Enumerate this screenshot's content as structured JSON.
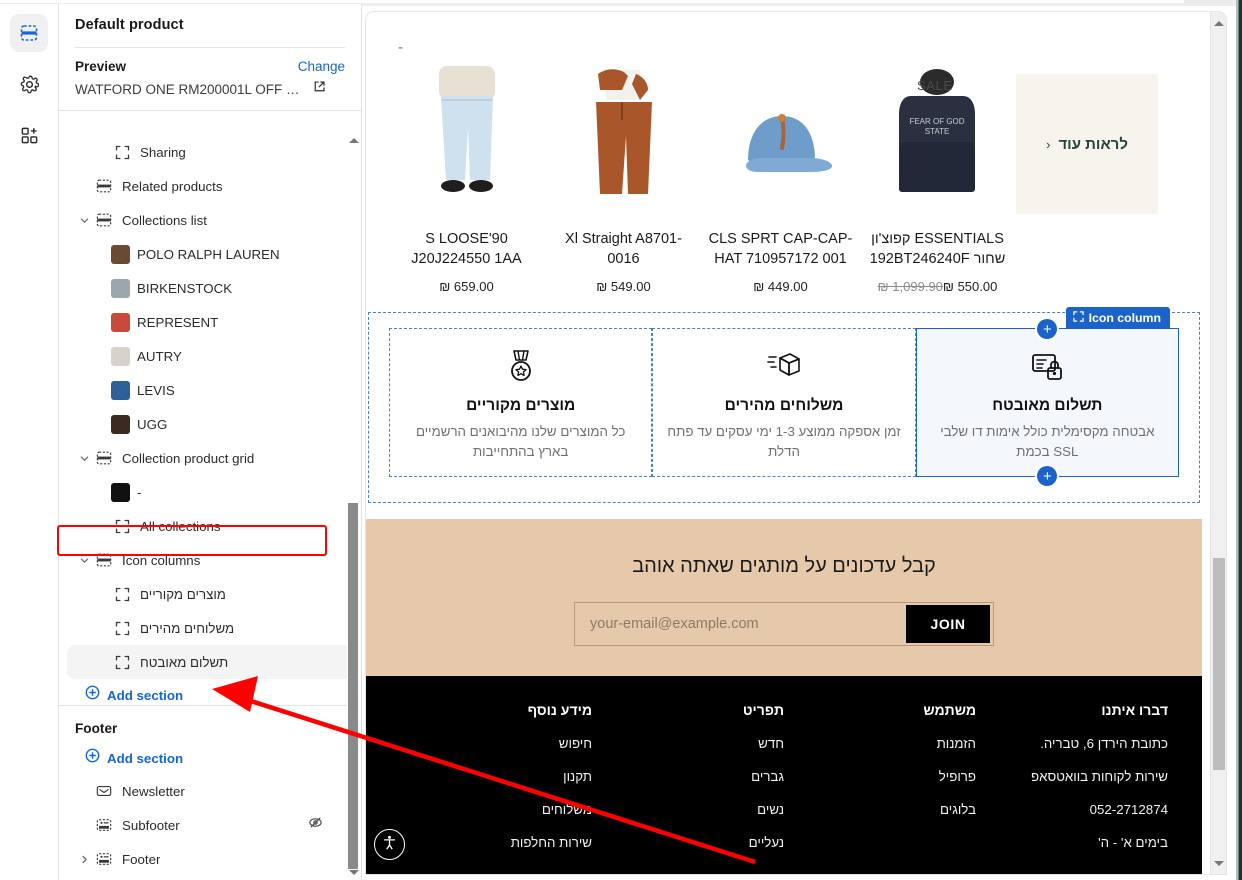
{
  "rail": {
    "items": [
      {
        "name": "sections-icon",
        "active": true
      },
      {
        "name": "settings-gear-icon",
        "active": false
      },
      {
        "name": "apps-add-icon",
        "active": false
      }
    ]
  },
  "sidebar": {
    "title": "Default product",
    "preview": {
      "label": "Preview",
      "change_label": "Change",
      "product_name": "WATFORD ONE RM200001L OFF WH..."
    },
    "tree": [
      {
        "label": "Sharing",
        "icon": "placeholder-block-icon",
        "indent": 2,
        "chevron": "none",
        "kind": "block"
      },
      {
        "label": "Related products",
        "icon": "section-icon",
        "indent": 1,
        "chevron": "none",
        "kind": "section"
      },
      {
        "label": "Collections list",
        "icon": "section-icon",
        "indent": 1,
        "chevron": "down",
        "kind": "section"
      },
      {
        "label": "POLO RALPH LAUREN",
        "icon": "thumb",
        "indent": 2,
        "chevron": "none",
        "kind": "thumb",
        "color": "#6b4a33"
      },
      {
        "label": "BIRKENSTOCK",
        "icon": "thumb",
        "indent": 2,
        "chevron": "none",
        "kind": "thumb",
        "color": "#9aa7ae"
      },
      {
        "label": "REPRESENT",
        "icon": "thumb",
        "indent": 2,
        "chevron": "none",
        "kind": "thumb",
        "color": "#c84a3a"
      },
      {
        "label": "AUTRY",
        "icon": "thumb",
        "indent": 2,
        "chevron": "none",
        "kind": "thumb",
        "color": "#d7d3cb"
      },
      {
        "label": "LEVIS",
        "icon": "thumb",
        "indent": 2,
        "chevron": "none",
        "kind": "thumb",
        "color": "#2f5f98"
      },
      {
        "label": "UGG",
        "icon": "thumb",
        "indent": 2,
        "chevron": "none",
        "kind": "thumb",
        "color": "#3a2a20"
      },
      {
        "label": "Collection product grid",
        "icon": "section-icon",
        "indent": 1,
        "chevron": "down",
        "kind": "section"
      },
      {
        "label": "-",
        "icon": "thumb",
        "indent": 2,
        "chevron": "none",
        "kind": "thumb",
        "color": "#111111"
      },
      {
        "label": "All collections",
        "icon": "placeholder-block-icon",
        "indent": 2,
        "chevron": "none",
        "kind": "block"
      },
      {
        "label": "Icon columns",
        "icon": "section-icon",
        "indent": 1,
        "chevron": "down",
        "kind": "section",
        "highlighted": true
      },
      {
        "label": "מוצרים מקוריים",
        "icon": "placeholder-block-icon",
        "indent": 2,
        "chevron": "none",
        "kind": "block",
        "rtl": true
      },
      {
        "label": "משלוחים מהירים",
        "icon": "placeholder-block-icon",
        "indent": 2,
        "chevron": "none",
        "kind": "block",
        "rtl": true
      },
      {
        "label": "תשלום מאובטח",
        "icon": "placeholder-block-icon",
        "indent": 2,
        "chevron": "none",
        "kind": "block",
        "rtl": true,
        "selected": true
      }
    ],
    "add_section_label": "Add section",
    "footer_group": {
      "title": "Footer",
      "add_section_label": "Add section",
      "items": [
        {
          "label": "Newsletter",
          "icon": "envelope-icon",
          "chevron": "none",
          "hidden": false
        },
        {
          "label": "Subfooter",
          "icon": "footer-icon",
          "chevron": "none",
          "hidden": true
        },
        {
          "label": "Footer",
          "icon": "footer-icon",
          "chevron": "right",
          "hidden": false
        }
      ]
    }
  },
  "preview": {
    "placeholder_dash": "-",
    "products": [
      {
        "name": "S LOOSE'90 J20J224550 1AA",
        "price": "₪ 659.00",
        "compare_price": "",
        "sale": false,
        "rtl": false
      },
      {
        "name": "Xl Straight A8701-0016",
        "price": "₪ 549.00",
        "compare_price": "",
        "sale": false,
        "rtl": false
      },
      {
        "name": "CLS SPRT CAP-CAP-HAT 710957172 001",
        "price": "₪ 449.00",
        "compare_price": "",
        "sale": false,
        "rtl": false
      },
      {
        "name": "ESSENTIALS קפוצ'ון שחור 192BT246240F",
        "price": "₪ 550.00",
        "compare_price": "₪ 1,099.90",
        "sale": true,
        "sale_label": "SALE",
        "rtl": true
      }
    ],
    "see_more": {
      "label": "לראות עוד",
      "chevron": "‹"
    },
    "icon_columns": {
      "badge_label": "Icon column",
      "columns": [
        {
          "icon": "medal-icon",
          "title": "מוצרים מקוריים",
          "desc": "כל המוצרים שלנו מהיבואנים הרשמיים בארץ בהתחייבות",
          "active": false
        },
        {
          "icon": "fast-box-icon",
          "title": "משלוחים מהירים",
          "desc": "זמן אספקה ממוצע 1-3 ימי עסקים עד פתח הדלת",
          "active": false
        },
        {
          "icon": "secure-payment-lock-icon",
          "title": "תשלום מאובטח",
          "desc": "אבטחה מקסימלית כולל אימות דו שלבי SSL בכמת",
          "active": true
        }
      ]
    },
    "newsletter": {
      "heading": "קבל עדכונים על מותגים שאתה אוהב",
      "placeholder": "your-email@example.com",
      "value": "",
      "button_label": "JOIN",
      "bg_color": "#e6c9ab"
    },
    "footer": {
      "columns": [
        {
          "title": "מידע נוסף",
          "links": [
            "חיפוש",
            "תקנון",
            "משלוחים",
            "שירות החלפות"
          ]
        },
        {
          "title": "תפריט",
          "links": [
            "חדש",
            "גברים",
            "נשים",
            "נעליים"
          ]
        },
        {
          "title": "משתמש",
          "links": [
            "הזמנות",
            "פרופיל",
            "בלוגים"
          ]
        },
        {
          "title": "דברו איתנו",
          "links": [
            "כתובת הירדן 6, טבריה.",
            "שירות לקוחות בוואטסאפ",
            "052-2712874",
            "בימים א' - ה'"
          ]
        }
      ],
      "accessibility_icon": "accessibility-person-icon"
    }
  },
  "colors": {
    "accent": "#1565d8",
    "annotation": "#ff0000",
    "newsletter_bg": "#e6c9ab",
    "footer_bg": "#000000",
    "see_more_bg": "#f7f4ee"
  }
}
